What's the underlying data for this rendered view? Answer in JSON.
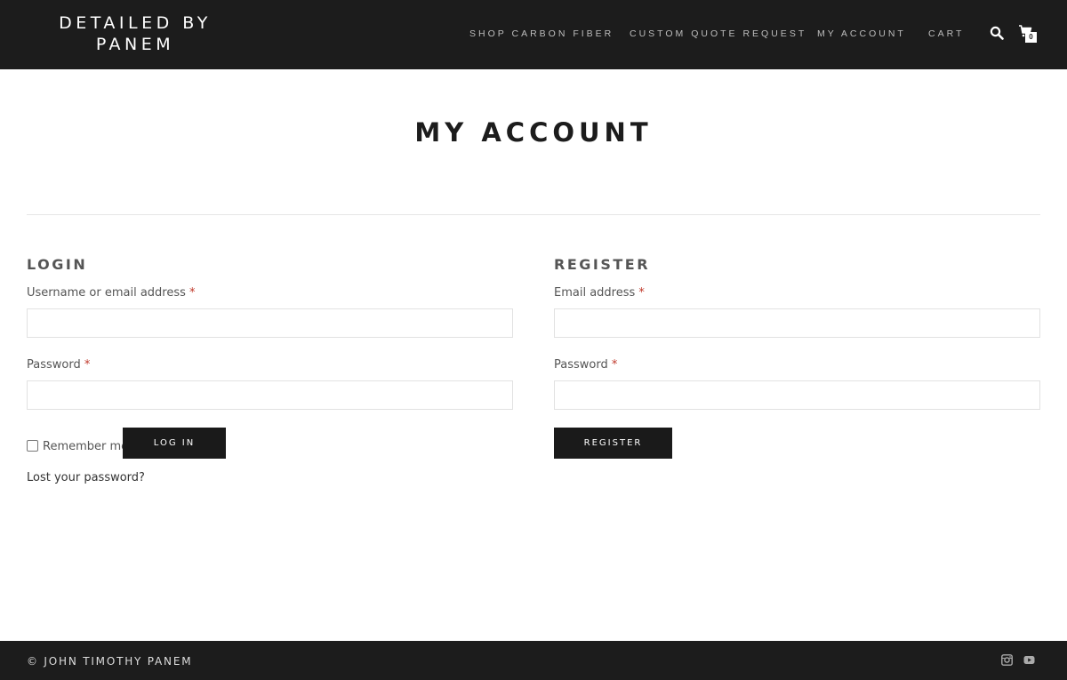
{
  "header": {
    "logo": "DETAILED BY PANEM",
    "nav": [
      {
        "label": "SHOP CARBON FIBER"
      },
      {
        "label": "CUSTOM QUOTE REQUEST"
      },
      {
        "label": "MY ACCOUNT"
      },
      {
        "label": "CART"
      }
    ],
    "cart_count": "0",
    "icons": {
      "search": "search-icon",
      "cart": "cart-icon"
    }
  },
  "page": {
    "title": "MY ACCOUNT"
  },
  "login": {
    "title": "LOGIN",
    "username_label": "Username or email address",
    "username_value": "",
    "password_label": "Password",
    "password_value": "",
    "required_mark": "*",
    "remember_label": "Remember me",
    "submit_label": "LOG IN",
    "lost_password": "Lost your password?"
  },
  "register": {
    "title": "REGISTER",
    "email_label": "Email address",
    "email_value": "",
    "password_label": "Password",
    "password_value": "",
    "required_mark": "*",
    "submit_label": "REGISTER"
  },
  "footer": {
    "copyright": "© JOHN TIMOTHY PANEM",
    "social": [
      "instagram-icon",
      "youtube-icon"
    ]
  },
  "colors": {
    "header_bg": "#1c1c1c",
    "required": "#c0392b",
    "button_bg": "#1a1a1a"
  }
}
